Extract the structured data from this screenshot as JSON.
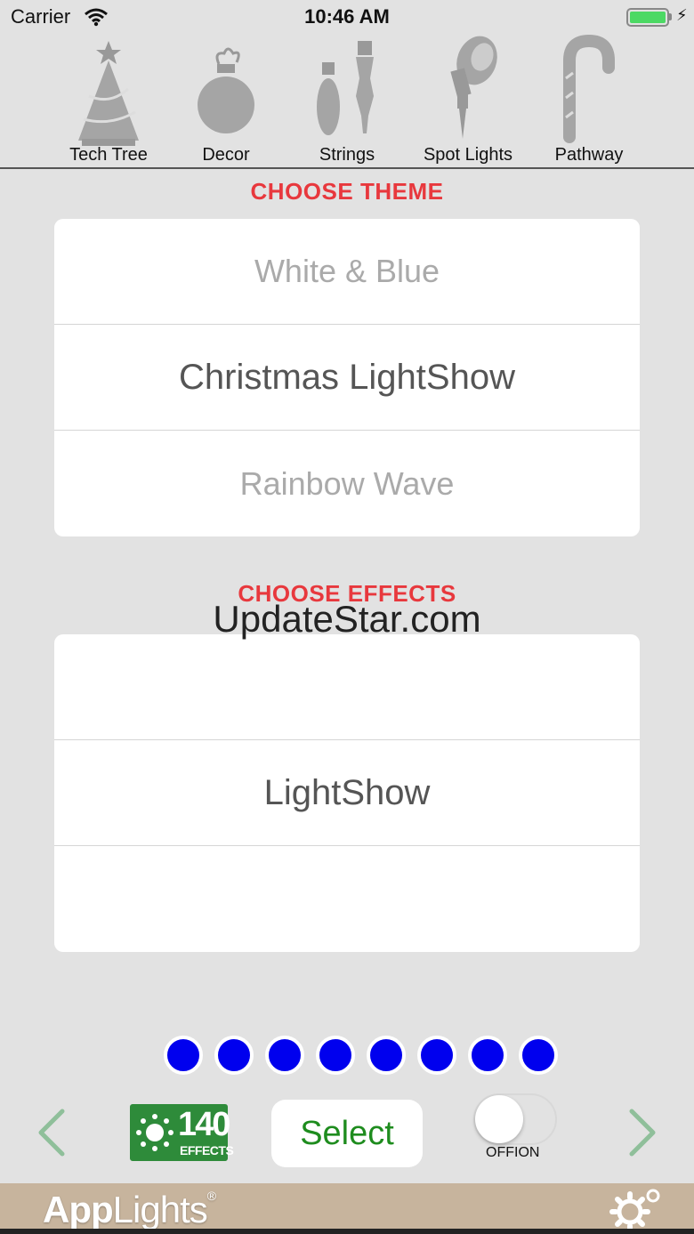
{
  "status_bar": {
    "carrier": "Carrier",
    "time": "10:46 AM"
  },
  "categories": [
    {
      "label": "Tech Tree",
      "icon": "christmas-tree-icon"
    },
    {
      "label": "Decor",
      "icon": "ornament-icon"
    },
    {
      "label": "Strings",
      "icon": "string-lights-icon"
    },
    {
      "label": "Spot Lights",
      "icon": "spotlight-icon"
    },
    {
      "label": "Pathway",
      "icon": "candy-cane-icon"
    }
  ],
  "theme": {
    "title": "CHOOSE THEME",
    "options": [
      "White & Blue",
      "Christmas LightShow",
      "Rainbow Wave"
    ],
    "selected": "Christmas LightShow"
  },
  "effects": {
    "title": "CHOOSE EFFECTS",
    "options": [
      "",
      "LightShow",
      ""
    ],
    "selected": "LightShow"
  },
  "watermark": "UpdateStar.com",
  "page_dots": 8,
  "toolbar": {
    "effects_count": "140",
    "effects_word": "EFFECTS",
    "select_label": "Select",
    "toggle_label": "OFFION",
    "toggle_on": false
  },
  "footer": {
    "brand_app": "App",
    "brand_lights": "Lights",
    "brand_reg": "®"
  },
  "colors": {
    "accent_red": "#e8383d",
    "select_green": "#1e8c1e",
    "dot_blue": "#0000ee",
    "badge_green": "#2e8b3a",
    "footer_tan": "#c7b49d"
  }
}
